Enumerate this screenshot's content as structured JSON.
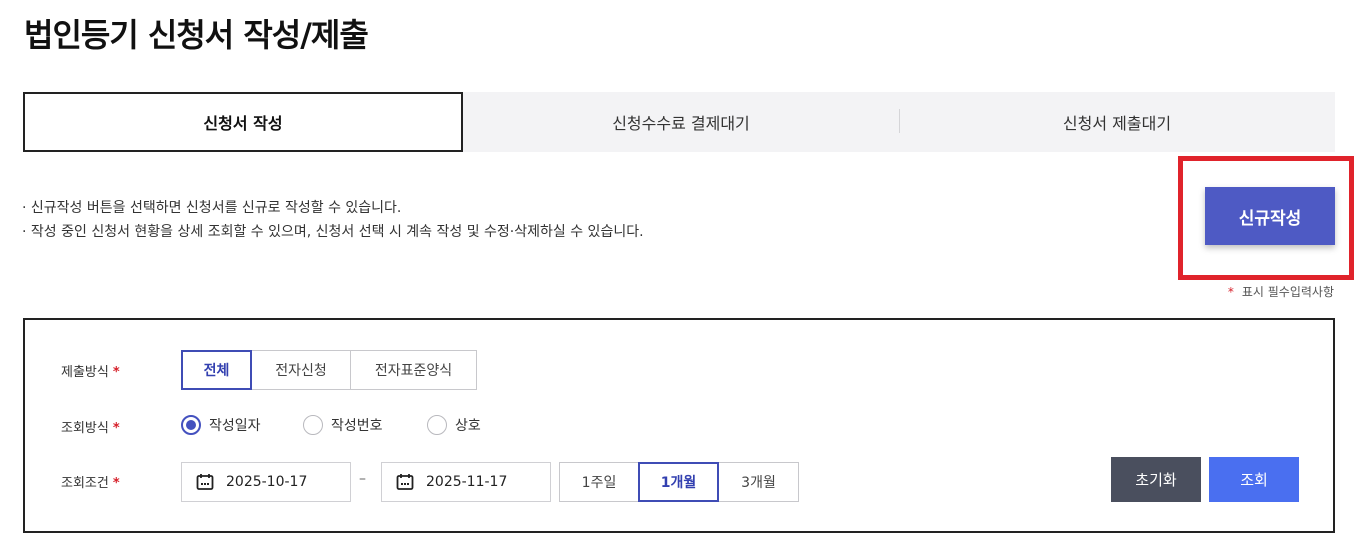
{
  "page": {
    "title": "법인등기 신청서 작성/제출"
  },
  "tabs": [
    {
      "label": "신청서 작성",
      "active": true
    },
    {
      "label": "신청수수료 결제대기",
      "active": false
    },
    {
      "label": "신청서 제출대기",
      "active": false
    }
  ],
  "notice": {
    "line1": "· 신규작성 버튼을 선택하면 신청서를 신규로 작성할 수 있습니다.",
    "line2": "· 작성 중인 신청서 현황을 상세 조회할 수 있으며, 신청서 선택 시 계속 작성 및 수정·삭제하실 수 있습니다."
  },
  "new_button": {
    "label": "신규작성",
    "color": "#4e5ac4",
    "highlight_color": "#e0232b"
  },
  "required_note": {
    "star": "*",
    "text": "표시 필수입력사항"
  },
  "search": {
    "submit_method": {
      "label": "제출방식",
      "star": "*",
      "options": [
        "전체",
        "전자신청",
        "전자표준양식"
      ],
      "selected": "전체"
    },
    "query_method": {
      "label": "조회방식",
      "star": "*",
      "options": [
        "작성일자",
        "작성번호",
        "상호"
      ],
      "selected": "작성일자"
    },
    "query_condition": {
      "label": "조회조건",
      "star": "*",
      "start_date": "2025-10-17",
      "separator": "–",
      "end_date": "2025-11-17",
      "icon": "calendar-icon",
      "periods": [
        "1주일",
        "1개월",
        "3개월"
      ],
      "selected_period": "1개월"
    },
    "reset_label": "초기화",
    "search_label": "조회"
  }
}
